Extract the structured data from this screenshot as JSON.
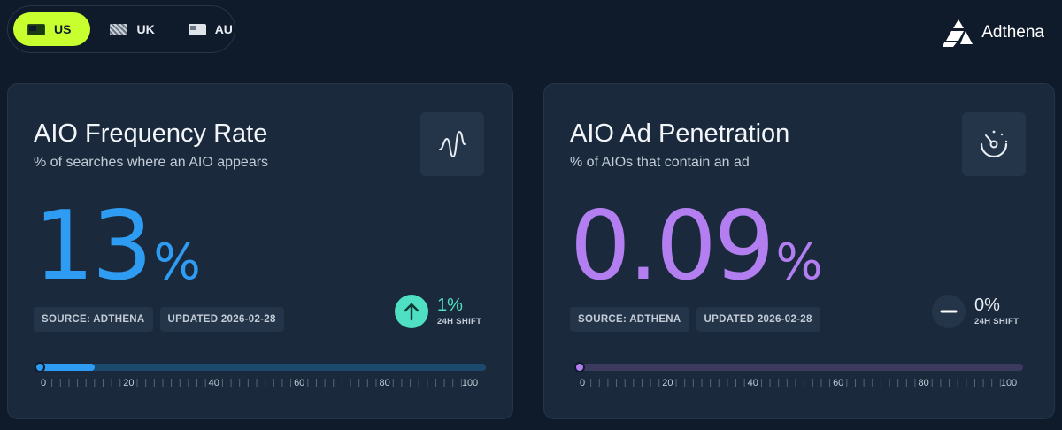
{
  "regions": [
    {
      "code": "US",
      "flag": "us",
      "active": true
    },
    {
      "code": "UK",
      "flag": "uk",
      "active": false
    },
    {
      "code": "AU",
      "flag": "au",
      "active": false
    }
  ],
  "logo": {
    "text": "Adthena"
  },
  "cards": [
    {
      "title": "AIO Frequency Rate",
      "subtitle": "% of searches where an AIO appears",
      "icon": "waveform-icon",
      "value": "13",
      "unit": "%",
      "source": "SOURCE: ADTHENA",
      "updated": "UPDATED 2026-02-28",
      "shift_value": "1%",
      "shift_label": "24H SHIFT",
      "shift_icon": "arrow-up-icon",
      "gauge_fraction": 0.13,
      "scale_labels": [
        "0",
        "20",
        "40",
        "60",
        "80",
        "100"
      ],
      "accent": "#2f9cf4"
    },
    {
      "title": "AIO Ad Penetration",
      "subtitle": "% of AIOs that contain an ad",
      "icon": "gauge-dial-icon",
      "value": "0.09",
      "unit": "%",
      "source": "SOURCE: ADTHENA",
      "updated": "UPDATED 2026-02-28",
      "shift_value": "0%",
      "shift_label": "24H SHIFT",
      "shift_icon": "dash-icon",
      "gauge_fraction": 0.0009,
      "scale_labels": [
        "0",
        "20",
        "40",
        "60",
        "80",
        "100"
      ],
      "accent": "#b27ef0"
    }
  ]
}
